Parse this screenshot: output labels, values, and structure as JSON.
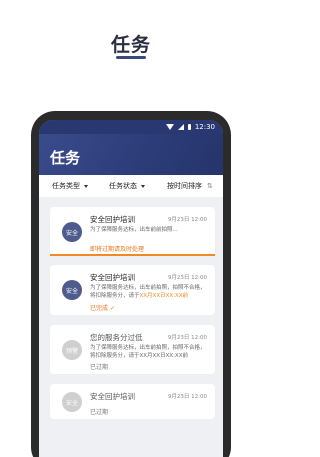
{
  "promo": {
    "title": "任务"
  },
  "status_bar": {
    "time": "12:30"
  },
  "app": {
    "title": "任务"
  },
  "filters": [
    {
      "label": "任务类型"
    },
    {
      "label": "任务状态"
    },
    {
      "label": "按时间排序"
    }
  ],
  "tasks": [
    {
      "badge": "安全",
      "title": "安全回护培训",
      "date": "9月23日 12:00",
      "desc": "为了保障服务达标，出车前前拍照...",
      "desc_warn": "",
      "status": "即将过期请及时处理"
    },
    {
      "badge": "安全",
      "title": "安全回护培训",
      "date": "9月23日 12:00",
      "desc": "为了保障服务达标，出车前拍照，拍照不合格，将扣除服务分，请于",
      "desc_warn": "XX月XX日XX:XX前",
      "status": "已完成"
    },
    {
      "badge": "预警",
      "title": "您的服务分过低",
      "date": "9月23日 12:00",
      "desc": "为了保障服务达标，出车前拍照，拍照不合格，将扣除服务分，请于XX月XX日XX:XX前",
      "desc_warn": "",
      "status": "已过期"
    },
    {
      "badge": "安全",
      "title": "安全回护培训",
      "date": "9月23日 12:00",
      "desc": "",
      "desc_warn": "",
      "status": "已过期"
    }
  ],
  "colors": {
    "accent": "#f08a24",
    "primary": "#2d3d7a"
  }
}
